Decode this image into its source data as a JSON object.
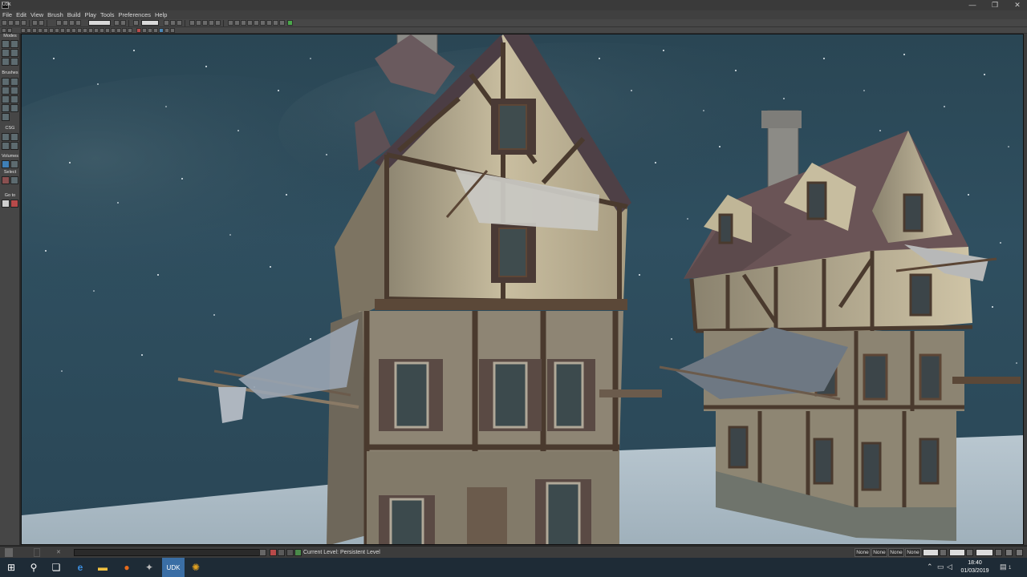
{
  "window": {
    "app_icon_label": "UDK",
    "minimize_glyph": "—",
    "restore_glyph": "❐",
    "close_glyph": "✕"
  },
  "menu": [
    "File",
    "Edit",
    "View",
    "Brush",
    "Build",
    "Play",
    "Tools",
    "Preferences",
    "Help"
  ],
  "left_panel": {
    "sections": [
      "Modes",
      "Brushes",
      "CSG",
      "Volumes",
      "Select",
      "Go to"
    ]
  },
  "status_bar": {
    "current_level_label": "Current Level:",
    "current_level_value": "Persistent Level",
    "snap_boxes": [
      "None",
      "None",
      "None",
      "None"
    ]
  },
  "taskbar": {
    "time": "18:40",
    "date": "01/03/2019",
    "notification_count": "1"
  },
  "colors": {
    "sky_top": "#2a4654",
    "ground": "#aab9c3",
    "taskbar": "#1e2b36",
    "active_task": "#3a6ea5"
  }
}
